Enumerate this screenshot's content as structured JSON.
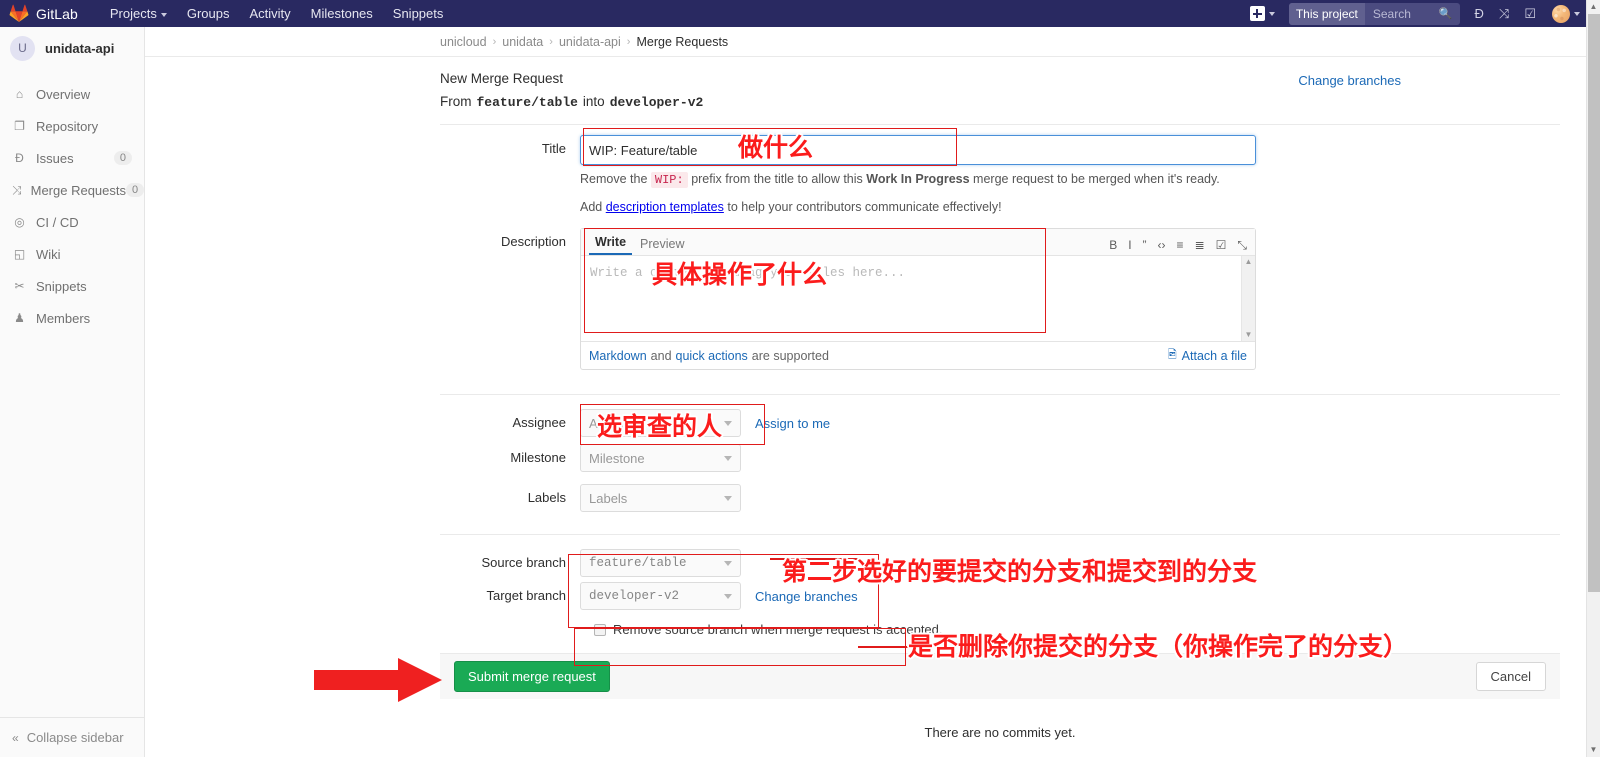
{
  "topnav": {
    "brand": "GitLab",
    "logo_icon": "gitlab-tanuki-icon",
    "links": [
      {
        "label": "Projects",
        "has_caret": true
      },
      {
        "label": "Groups",
        "has_caret": false
      },
      {
        "label": "Activity",
        "has_caret": false
      },
      {
        "label": "Milestones",
        "has_caret": false
      },
      {
        "label": "Snippets",
        "has_caret": false
      }
    ],
    "plus_icon": "plus-square-icon",
    "search": {
      "scope": "This project",
      "placeholder": "Search",
      "icon": "search-icon"
    },
    "icons": [
      {
        "name": "issues-icon",
        "glyph": "Đ"
      },
      {
        "name": "merge-requests-icon",
        "glyph": "⤨"
      },
      {
        "name": "todos-icon",
        "glyph": "☑"
      }
    ],
    "avatar_icon": "user-avatar",
    "avatar_caret": true
  },
  "sidebar": {
    "project": {
      "initial": "U",
      "name": "unidata-api"
    },
    "items": [
      {
        "label": "Overview",
        "icon": "home-icon",
        "glyph": "⌂",
        "count": null
      },
      {
        "label": "Repository",
        "icon": "document-icon",
        "glyph": "❐",
        "count": null
      },
      {
        "label": "Issues",
        "icon": "issues-icon",
        "glyph": "Đ",
        "count": "0"
      },
      {
        "label": "Merge Requests",
        "icon": "merge-request-icon",
        "glyph": "⤨",
        "count": "0"
      },
      {
        "label": "CI / CD",
        "icon": "rocket-icon",
        "glyph": "◎",
        "count": null
      },
      {
        "label": "Wiki",
        "icon": "book-icon",
        "glyph": "◱",
        "count": null
      },
      {
        "label": "Snippets",
        "icon": "scissors-icon",
        "glyph": "✂",
        "count": null
      },
      {
        "label": "Members",
        "icon": "users-icon",
        "glyph": "♟",
        "count": null
      }
    ],
    "collapse": {
      "label": "Collapse sidebar",
      "icon": "chevron-double-left-icon",
      "glyph": "«"
    }
  },
  "breadcrumb": {
    "items": [
      "unicloud",
      "unidata",
      "unidata-api"
    ],
    "current": "Merge Requests",
    "separator": "›"
  },
  "header": {
    "page_title": "New Merge Request",
    "from_word": "From",
    "source_branch": "feature/table",
    "into_word": "into",
    "target_branch": "developer-v2",
    "change_branches_label": "Change branches"
  },
  "form": {
    "title_label": "Title",
    "title_value": "WIP: Feature/table",
    "helper_prefix": "Remove the",
    "helper_code": "WIP:",
    "helper_mid": "prefix from the title to allow this",
    "helper_bold": "Work In Progress",
    "helper_suffix": "merge request to be merged when it's ready.",
    "templates_prefix": "Add",
    "templates_link": "description templates",
    "templates_suffix": "to help your contributors communicate effectively!",
    "description_label": "Description",
    "tab_write": "Write",
    "tab_preview": "Preview",
    "description_placeholder": "Write a comment or drag your files here...",
    "md_tools": [
      {
        "name": "bold-icon",
        "glyph": "B"
      },
      {
        "name": "italic-icon",
        "glyph": "I"
      },
      {
        "name": "quote-icon",
        "glyph": "”"
      },
      {
        "name": "code-icon",
        "glyph": "‹›"
      },
      {
        "name": "bullet-list-icon",
        "glyph": "≡"
      },
      {
        "name": "numbered-list-icon",
        "glyph": "≣"
      },
      {
        "name": "task-list-icon",
        "glyph": "☑"
      },
      {
        "name": "fullscreen-icon",
        "glyph": "⤡"
      }
    ],
    "markdown_link": "Markdown",
    "and_word": "and",
    "quick_actions_link": "quick actions",
    "supported_suffix": "are supported",
    "attach_label": "Attach a file",
    "attach_icon": "image-icon",
    "assignee_label": "Assignee",
    "assignee_placeholder": "Assignee",
    "assign_to_me": "Assign to me",
    "milestone_label": "Milestone",
    "milestone_placeholder": "Milestone",
    "labels_label": "Labels",
    "labels_placeholder": "Labels",
    "source_branch_label": "Source branch",
    "source_branch_value": "feature/table",
    "target_branch_label": "Target branch",
    "target_branch_value": "developer-v2",
    "change_branches_inline": "Change branches",
    "remove_branch_checkbox": "Remove source branch when merge request is accepted.",
    "submit_label": "Submit merge request",
    "cancel_label": "Cancel",
    "no_commits": "There are no commits yet."
  },
  "annotations": {
    "title": "做什么",
    "description": "具体操作了什么",
    "assignee": "选审查的人",
    "branches": "第二步选好的要提交的分支和提交到的分支",
    "remove_branch": "是否删除你提交的分支（你操作完了的分支）",
    "arrow_icon": "red-arrow-pointing-right"
  },
  "colors": {
    "nav_bg": "#292961",
    "link": "#1b69b6",
    "submit_green": "#1aaa55",
    "annotation_red": "#fb1c1c",
    "annotation_border": "#e01b1b"
  }
}
